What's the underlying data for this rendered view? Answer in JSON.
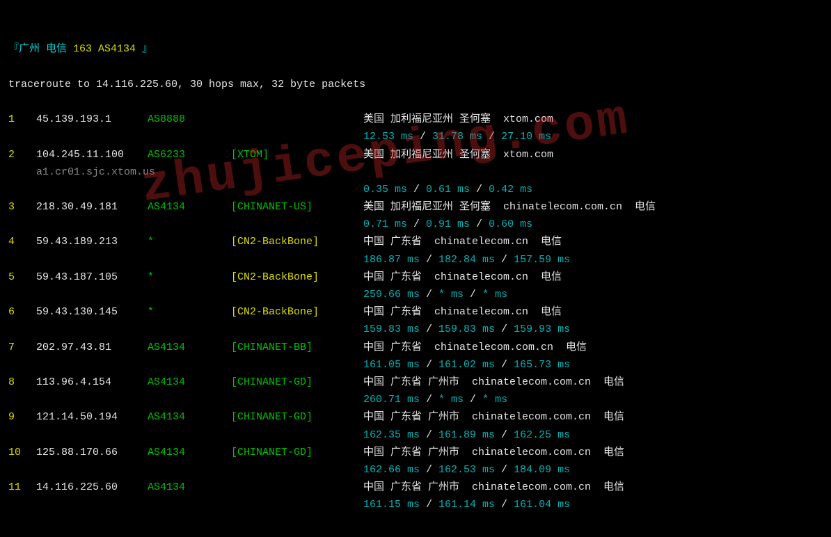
{
  "header": {
    "prefix": "『",
    "location": "广州 电信",
    "asn": "163 AS4134",
    "suffix": "』",
    "traceroute_line": "traceroute to 14.116.225.60, 30 hops max, 32 byte packets"
  },
  "watermark": "zhujiceping.com",
  "hops": [
    {
      "n": "1",
      "ip": "45.139.193.1",
      "asn": "AS8888",
      "name": "",
      "hostname": "",
      "loc": "美国 加利福尼亚州 圣何塞  xtom.com",
      "times": [
        "12.53 ms",
        "31.78 ms",
        "27.10 ms"
      ]
    },
    {
      "n": "2",
      "ip": "104.245.11.100",
      "asn": "AS6233",
      "name": "[XTOM]",
      "hostname": "a1.cr01.sjc.xtom.us",
      "loc": "美国 加利福尼亚州 圣何塞  xtom.com",
      "times": [
        "0.35 ms",
        "0.61 ms",
        "0.42 ms"
      ]
    },
    {
      "n": "3",
      "ip": "218.30.49.181",
      "asn": "AS4134",
      "name": "[CHINANET-US]",
      "hostname": "",
      "loc": "美国 加利福尼亚州 圣何塞  chinatelecom.com.cn  电信",
      "times": [
        "0.71 ms",
        "0.91 ms",
        "0.60 ms"
      ]
    },
    {
      "n": "4",
      "ip": "59.43.189.213",
      "asn": "*",
      "name": "[CN2-BackBone]",
      "hostname": "",
      "loc": "中国 广东省  chinatelecom.cn  电信",
      "times": [
        "186.87 ms",
        "182.84 ms",
        "157.59 ms"
      ]
    },
    {
      "n": "5",
      "ip": "59.43.187.105",
      "asn": "*",
      "name": "[CN2-BackBone]",
      "hostname": "",
      "loc": "中国 广东省  chinatelecom.cn  电信",
      "times": [
        "259.66 ms",
        "* ms",
        "* ms"
      ]
    },
    {
      "n": "6",
      "ip": "59.43.130.145",
      "asn": "*",
      "name": "[CN2-BackBone]",
      "hostname": "",
      "loc": "中国 广东省  chinatelecom.cn  电信",
      "times": [
        "159.83 ms",
        "159.83 ms",
        "159.93 ms"
      ]
    },
    {
      "n": "7",
      "ip": "202.97.43.81",
      "asn": "AS4134",
      "name": "[CHINANET-BB]",
      "hostname": "",
      "loc": "中国 广东省  chinatelecom.com.cn  电信",
      "times": [
        "161.05 ms",
        "161.02 ms",
        "165.73 ms"
      ]
    },
    {
      "n": "8",
      "ip": "113.96.4.154",
      "asn": "AS4134",
      "name": "[CHINANET-GD]",
      "hostname": "",
      "loc": "中国 广东省 广州市  chinatelecom.com.cn  电信",
      "times": [
        "260.71 ms",
        "* ms",
        "* ms"
      ]
    },
    {
      "n": "9",
      "ip": "121.14.50.194",
      "asn": "AS4134",
      "name": "[CHINANET-GD]",
      "hostname": "",
      "loc": "中国 广东省 广州市  chinatelecom.com.cn  电信",
      "times": [
        "162.35 ms",
        "161.89 ms",
        "162.25 ms"
      ]
    },
    {
      "n": "10",
      "ip": "125.88.170.66",
      "asn": "AS4134",
      "name": "[CHINANET-GD]",
      "hostname": "",
      "loc": "中国 广东省 广州市  chinatelecom.com.cn  电信",
      "times": [
        "162.66 ms",
        "162.53 ms",
        "184.09 ms"
      ]
    },
    {
      "n": "11",
      "ip": "14.116.225.60",
      "asn": "AS4134",
      "name": "",
      "hostname": "",
      "loc": "中国 广东省 广州市  chinatelecom.com.cn  电信",
      "times": [
        "161.15 ms",
        "161.14 ms",
        "161.04 ms"
      ]
    }
  ]
}
